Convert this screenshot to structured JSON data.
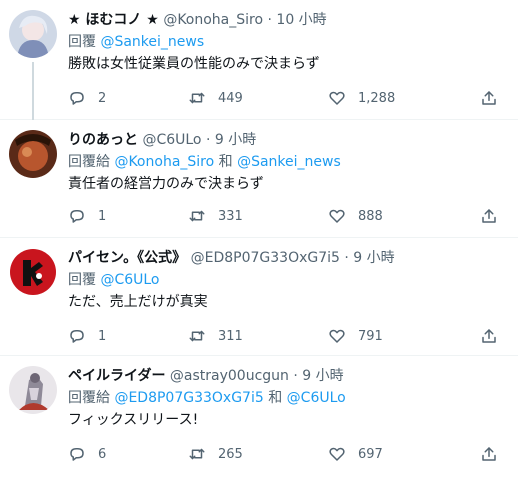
{
  "tweets": [
    {
      "name": "★ ほむコノ ★",
      "handle": "@Konoha_Siro",
      "time": "10 小時",
      "reply_prefix": "回覆",
      "reply_mention_1": "@Sankei_news",
      "reply_join": "",
      "reply_mention_2": "",
      "text": "勝敗は女性従業員の性能のみで決まらず",
      "replies": "2",
      "retweets": "449",
      "likes": "1,288"
    },
    {
      "name": "りのあっと",
      "handle": "@C6ULo",
      "time": "9 小時",
      "reply_prefix": "回覆給",
      "reply_mention_1": "@Konoha_Siro",
      "reply_join": "和",
      "reply_mention_2": "@Sankei_news",
      "text": "責任者の経営力のみで決まらず",
      "replies": "1",
      "retweets": "331",
      "likes": "888"
    },
    {
      "name": "パイセン。《公式》",
      "handle": "@ED8P07G33OxG7i5",
      "time": "9 小時",
      "reply_prefix": "回覆",
      "reply_mention_1": "@C6ULo",
      "reply_join": "",
      "reply_mention_2": "",
      "text": "ただ、売上だけが真実",
      "replies": "1",
      "retweets": "311",
      "likes": "791"
    },
    {
      "name": "ペイルライダー",
      "handle": "@astray00ucgun",
      "time": "9 小時",
      "reply_prefix": "回覆給",
      "reply_mention_1": "@ED8P07G33OxG7i5",
      "reply_join": "和",
      "reply_mention_2": "@C6ULo",
      "text": "フィックスリリース!",
      "replies": "6",
      "retweets": "265",
      "likes": "697"
    }
  ],
  "separator": "·",
  "colors": {
    "link": "#1d9bf0",
    "secondary": "#536471",
    "text": "#0f1419",
    "border": "#eff3f4"
  },
  "icons": {
    "reply": "reply-icon",
    "retweet": "retweet-icon",
    "like": "heart-icon",
    "share": "share-icon"
  }
}
